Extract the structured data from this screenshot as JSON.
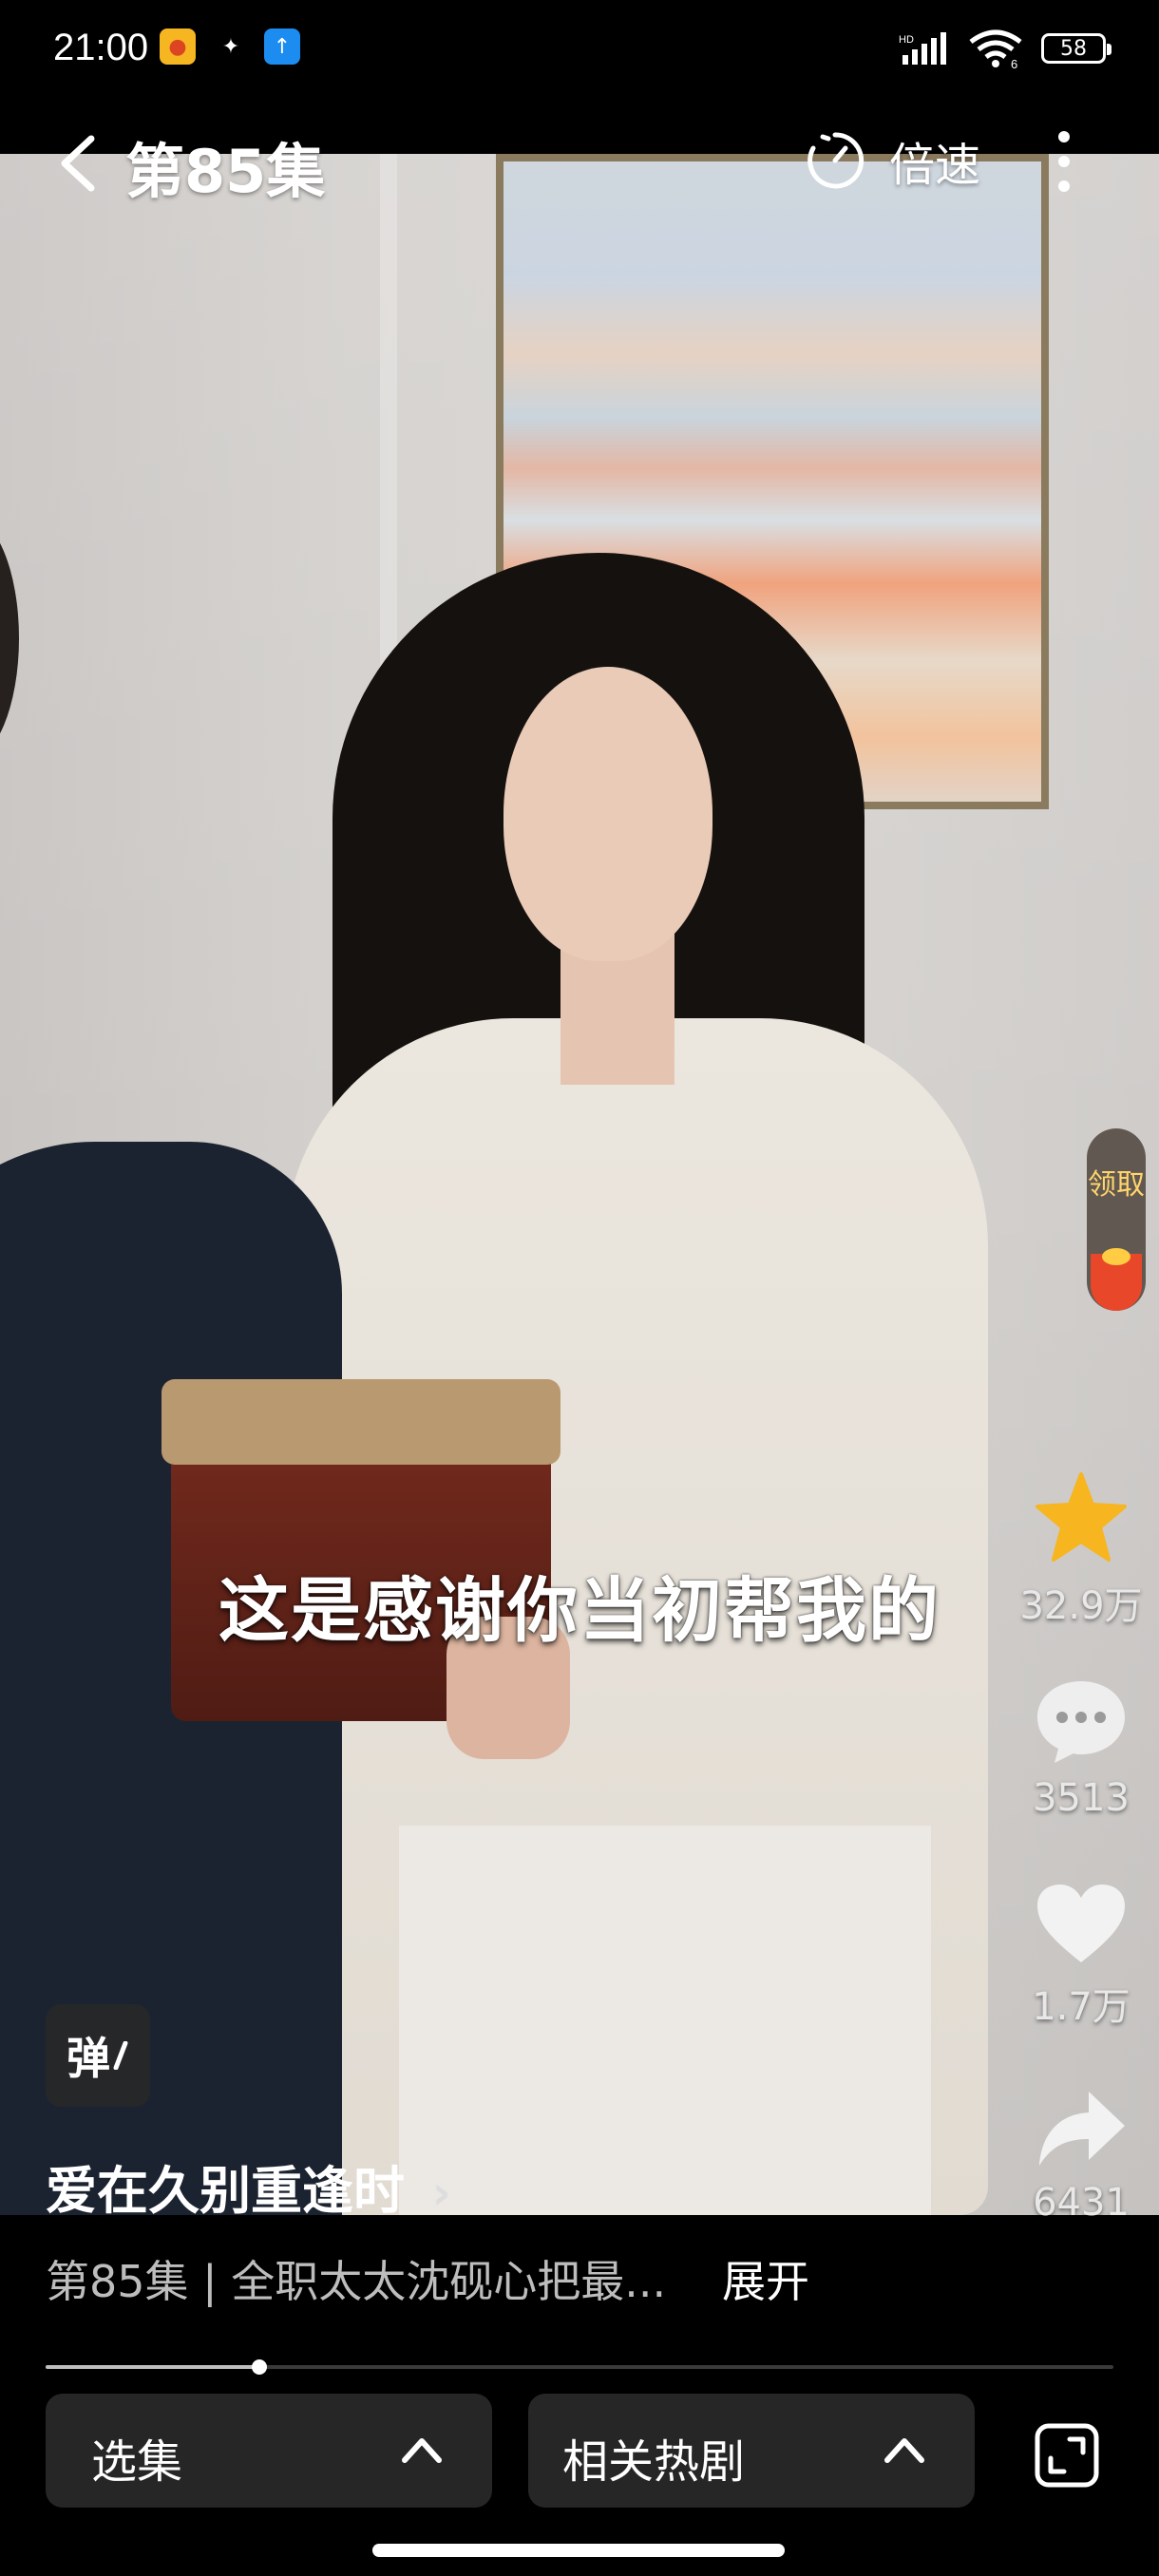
{
  "status": {
    "time": "21:00",
    "network": "HD",
    "battery": "58",
    "wifi_badge": "6"
  },
  "header": {
    "episode": "第85集",
    "speed_label": "倍速"
  },
  "subtitle": "这是感谢你当初帮我的",
  "reward": {
    "label": "领取"
  },
  "actions": {
    "favorite_count": "32.9万",
    "comment_count": "3513",
    "like_count": "1.7万",
    "share_count": "6431"
  },
  "danmaku_label": "弹",
  "drama": {
    "title": "爱在久别重逢时",
    "title_arrow": "›",
    "description": "第85集 | 全职太太沈砚心把最...",
    "expand_label": "展开"
  },
  "progress": {
    "played_fraction": 0.2
  },
  "bottom": {
    "episodes_label": "选集",
    "related_label": "相关热剧"
  },
  "colors": {
    "accent_star": "#f7b51f",
    "reward_text": "#ffd46b"
  }
}
